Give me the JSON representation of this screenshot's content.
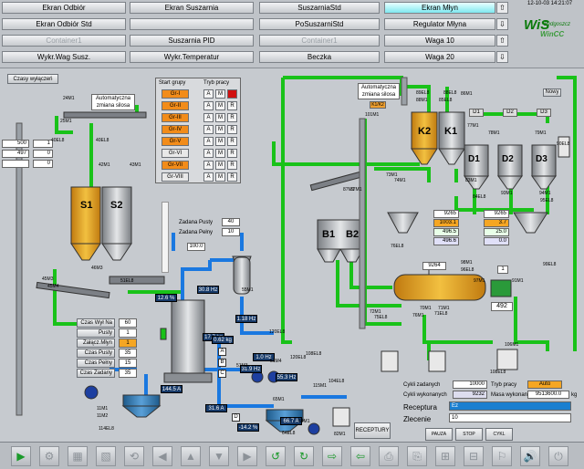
{
  "nav": {
    "rows": [
      [
        "Ekran Odbiór",
        "Ekran Suszarnia",
        "SuszarniaStd",
        "Ekran Młyn"
      ],
      [
        "Ekran Odbiór Std",
        "",
        "PoSuszarniStd",
        "Regulator Młyna"
      ],
      [
        "Container1",
        "Suszarnia PID",
        "Container1",
        "Waga 10"
      ],
      [
        "Wykr.Wag Susz.",
        "Wykr.Temperatur",
        "Beczka",
        "Waga 20"
      ]
    ],
    "arrows": [
      "⇧",
      "⇩",
      "⇧",
      "⇩"
    ]
  },
  "clock": "12-10-03 14:21:07",
  "logo": {
    "main": "WiS",
    "sub": "Bydgoszcz",
    "product": "WinCC"
  },
  "left": {
    "czasy_btn": "Czasy wyłączeń",
    "auto_label": "Automatyczna\nzmiana silosa",
    "readouts": [
      {
        "value": "500",
        "idx": "1"
      },
      {
        "value": "497",
        "idx": "0"
      },
      {
        "value": "",
        "idx": "0"
      }
    ]
  },
  "groups": {
    "header_start": "Start grupy",
    "header_mode": "Tryb pracy",
    "rows": [
      {
        "name": "Gr-I",
        "color": "#f28c1a",
        "a": "A",
        "m": "M",
        "r": "R",
        "r_red": true
      },
      {
        "name": "Gr-II",
        "color": "#f28c1a",
        "a": "A",
        "m": "M",
        "r": "R",
        "r_red": false
      },
      {
        "name": "Gr-III",
        "color": "#f28c1a",
        "a": "A",
        "m": "M",
        "r": "R",
        "r_red": false
      },
      {
        "name": "Gr-IV",
        "color": "#f28c1a",
        "a": "A",
        "m": "M",
        "r": "R",
        "r_red": false
      },
      {
        "name": "Gr-V",
        "color": "#f28c1a",
        "a": "A",
        "m": "M",
        "r": "R",
        "r_red": false
      },
      {
        "name": "Gr-VI",
        "color": "#e8e8e8",
        "a": "A",
        "m": "M",
        "r": "R",
        "r_red": false
      },
      {
        "name": "Gr-VII",
        "color": "#f28c1a",
        "a": "A",
        "m": "M",
        "r": "R",
        "r_red": false
      },
      {
        "name": "Gr-VIII",
        "color": "#e8e8e8",
        "a": "A",
        "m": "M",
        "r": "R",
        "r_red": false
      }
    ]
  },
  "zadana": {
    "pusty_label": "Zadana Pusty",
    "pusty_value": "40",
    "pelny_label": "Zadana Pełny",
    "pelny_value": "10",
    "extra": "100.0"
  },
  "czas_table": [
    {
      "label": "Czas Wył Na",
      "value": "60"
    },
    {
      "label": "Pusty",
      "value": "1"
    },
    {
      "label": "Załącz.Młyn",
      "value": "1"
    },
    {
      "label": "Czas Pusty",
      "value": "35"
    },
    {
      "label": "Czas Pełny",
      "value": "15"
    },
    {
      "label": "Czas Zadany",
      "value": "35"
    }
  ],
  "silos": {
    "s1": "S1",
    "s2": "S2",
    "k2": "K2",
    "k1": "K1",
    "b1": "B1",
    "b2": "B2",
    "d1": "D1",
    "d2": "D2",
    "d3": "D3"
  },
  "d_labels": [
    "D1",
    "D2",
    "D3"
  ],
  "weights": {
    "left_col": [
      "9265",
      "1003.1",
      "496.5",
      "496.6"
    ],
    "right_col": [
      "9265",
      "3.7",
      "25.0",
      "0.0"
    ],
    "mixer": "9264",
    "mixer_side": "1",
    "mixer_out": "492"
  },
  "mill": {
    "v1": "30.8 Hz",
    "v2": "12.6 %",
    "v3": "1.18 Hz",
    "v4": "17.7 kg",
    "v5": "0.62 kg",
    "v6": "1.0 Hz",
    "v7": "31.9 Hz",
    "v8": "144.5 A",
    "v9": "55.3 Hz",
    "v10": "31.6 A",
    "v11": "66.7 A",
    "v12": "-14.2 %"
  },
  "mini_cells": [
    "A",
    "B",
    "C",
    "D"
  ],
  "tags": [
    "24M1",
    "25M1",
    "40EL8",
    "40EL8",
    "42M1",
    "43M1",
    "45M3",
    "45M4",
    "46M3",
    "51EL8",
    "11M1",
    "11M2",
    "114EL8",
    "120EL8",
    "120EL8",
    "55M1",
    "51M3",
    "51M4",
    "65M1",
    "64M1",
    "82M1",
    "64EL8",
    "104EL8",
    "115M1",
    "108EL8",
    "101M1",
    "89EL8",
    "88M1",
    "88EL8",
    "85EL8",
    "86M1",
    "87M1",
    "73M1",
    "74M1",
    "83M1",
    "76EL8",
    "77M1",
    "78M1",
    "79M1",
    "84EL8",
    "93M1",
    "94M1",
    "95EL8",
    "98M1",
    "99EL8",
    "96EL8",
    "97M1",
    "91M1",
    "106M1",
    "108EL8",
    "37M1",
    "70M1",
    "71M1",
    "71EL8",
    "72M1",
    "75EL8",
    "76M1",
    "90EL8"
  ],
  "nowy_btn": "Nowy",
  "auto2_label": "Automatyczna\nzmiana silosa",
  "k1k2_tag": "K1/K2",
  "receptury_btn": "RECEPTURY",
  "bottom": {
    "cykli_zadanych_label": "Cykli zadanych",
    "cykli_zadanych": "10000",
    "cykli_wykonanych_label": "Cykli wykonanych",
    "cykli_wykonanych": "9232",
    "tryb_label": "Tryb pracy",
    "tryb_value": "Auto",
    "masa_label": "Masa wykonana",
    "masa_value": "9513600.0",
    "masa_unit": "kg",
    "receptura_label": "Receptura",
    "receptura_value": "Ez",
    "zlecenie_label": "Zlecenie",
    "zlecenie_value": "10",
    "pauza": "PAUZA",
    "stop": "STOP",
    "cykl": "CYKL"
  },
  "toolbar": [
    "▶",
    "⚙",
    "▦",
    "▧",
    "⟲",
    "◀",
    "▲",
    "▼",
    "▶",
    "↺",
    "↻",
    "⇨",
    "⇦",
    "⎙",
    "⎘",
    "⊞",
    "⊟",
    "⚐",
    "🔊",
    "⏻"
  ],
  "colors": {
    "green": "#19c219",
    "blue": "#1a78e0",
    "silo_yellow": "#e8a820",
    "silo_gray": "#a9adb2"
  }
}
